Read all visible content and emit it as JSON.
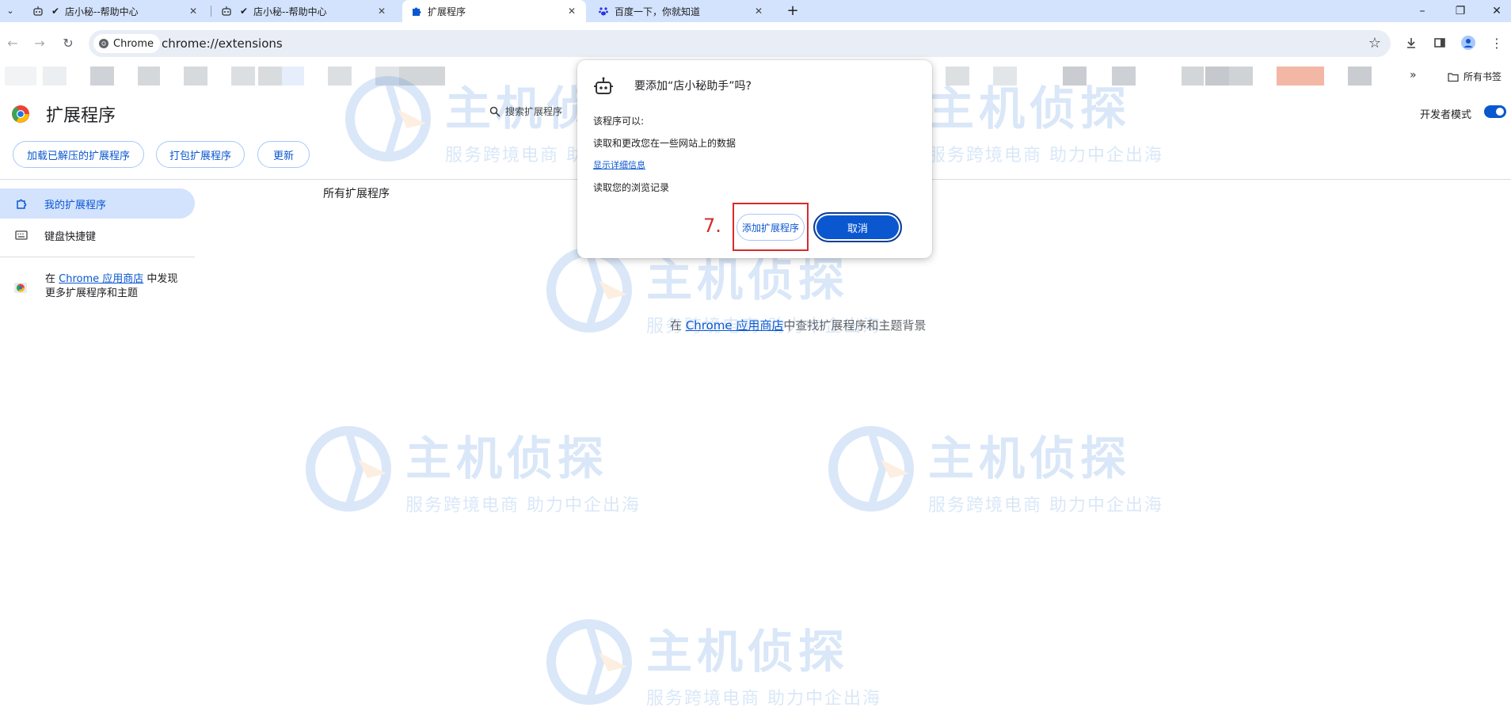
{
  "tabs": [
    {
      "title": "店小秘--帮助中心",
      "favicon": "robot-icon"
    },
    {
      "title": "店小秘--帮助中心",
      "favicon": "robot-icon"
    },
    {
      "title": "扩展程序",
      "favicon": "puzzle-icon",
      "active": true
    },
    {
      "title": "百度一下，你就知道",
      "favicon": "baidu-paw-icon"
    }
  ],
  "omnibox": {
    "chip": "Chrome",
    "url": "chrome://extensions"
  },
  "bookmarks": {
    "all_label": "所有书签"
  },
  "page": {
    "title": "扩展程序",
    "search_placeholder": "搜索扩展程序",
    "dev_mode_label": "开发者模式",
    "dev_mode_on": true,
    "buttons": {
      "load_unpacked": "加载已解压的扩展程序",
      "pack": "打包扩展程序",
      "update": "更新"
    },
    "sidebar": {
      "my_extensions": "我的扩展程序",
      "shortcuts": "键盘快捷键",
      "store_prefix": "在",
      "store_link": "Chrome 应用商店",
      "store_suffix": "中发现更多扩展程序和主题"
    },
    "section_title": "所有扩展程序",
    "main_store_prefix": "在",
    "main_store_link": "Chrome 应用商店",
    "main_store_suffix": "中查找扩展程序和主题背景"
  },
  "dialog": {
    "title": "要添加“店小秘助手”吗?",
    "can_label": "该程序可以:",
    "permission_1": "读取和更改您在一些网站上的数据",
    "details_link": "显示详细信息",
    "permission_2": "读取您的浏览记录",
    "add_button": "添加扩展程序",
    "cancel_button": "取消",
    "step_label": "7."
  },
  "watermark": {
    "brand": "主机侦探",
    "slogan": "服务跨境电商 助力中企出海"
  },
  "colors": {
    "accent": "#0b57d0",
    "tabstrip": "#d3e3fd",
    "highlight": "#d52b2b"
  }
}
